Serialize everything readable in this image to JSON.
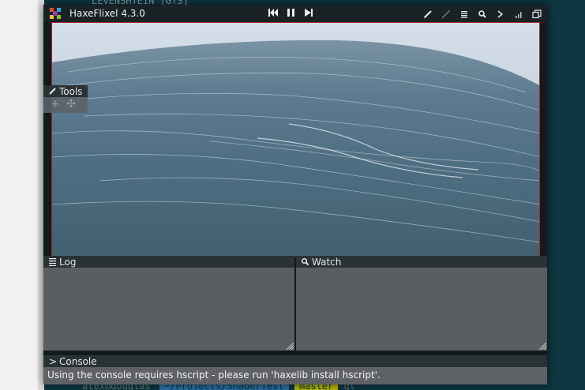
{
  "terminal": {
    "top_line": "LEVENSHTEIN [GTS]",
    "prompt_user": "alex@douglas",
    "prompt_path": "~/Projects/ShaderTest",
    "prompt_branch": "master",
    "prompt_cmd": "gt",
    "background": "#0d3640"
  },
  "window": {
    "title": "HaxeFlixel 4.3.0",
    "icons": {
      "logo": "haxeflixel-logo-icon",
      "rewind": "rewind-icon",
      "pause": "pause-icon",
      "step": "step-forward-icon",
      "draw": "pencil-icon",
      "debug_draw": "line-icon",
      "log": "list-icon",
      "watch": "magnifier-icon",
      "console": "console-icon",
      "stats": "stats-bars-icon",
      "windows": "windows-icon"
    }
  },
  "tools": {
    "label": "Tools"
  },
  "log": {
    "label": "Log"
  },
  "watch": {
    "label": "Watch"
  },
  "console": {
    "label": "Console",
    "message": "Using the console requires hscript - please run 'haxelib install hscript'."
  },
  "colors": {
    "viewport_border": "#b0222a",
    "panel_header": "#2a3236",
    "panel_body": "#5a5e60"
  }
}
